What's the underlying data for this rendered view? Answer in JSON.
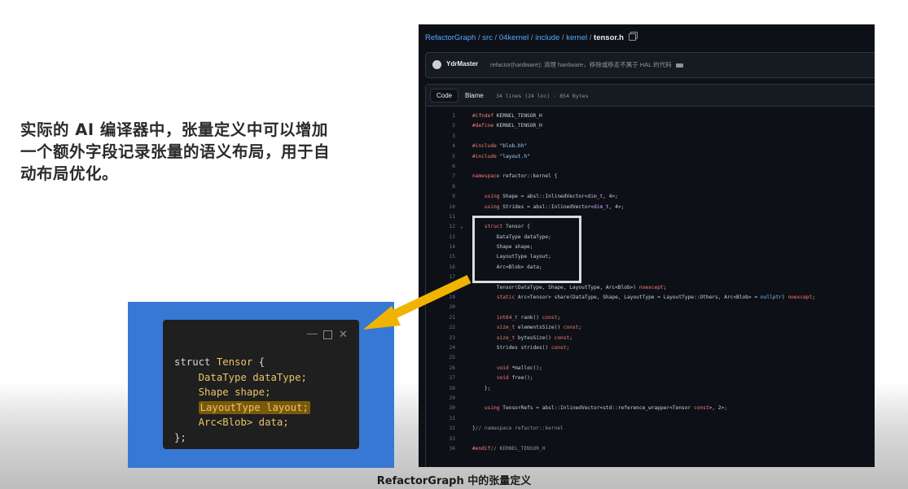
{
  "heading": "实际的 AI 编译器中，张量定义中可以增加一个额外字段记录张量的语义布局，用于自动布局优化。",
  "github": {
    "breadcrumb": {
      "repo": "RefactorGraph",
      "sep": " / ",
      "parts": [
        "src",
        "04kernel",
        "include",
        "kernel"
      ],
      "file": "tensor.h"
    },
    "commit": {
      "author": "YdrMaster",
      "message": "refactor(hardware): 清理 hardware，移除或移走不属于 HAL 的代码"
    },
    "tabs": {
      "code": "Code",
      "blame": "Blame"
    },
    "file_info": "34 lines (24 loc) · 854 Bytes",
    "code_lines": [
      {
        "n": "1",
        "t": "#ifndef KERNEL_TENSOR_H"
      },
      {
        "n": "2",
        "t": "#define KERNEL_TENSOR_H"
      },
      {
        "n": "3",
        "t": ""
      },
      {
        "n": "4",
        "t": "#include \"blob.hh\""
      },
      {
        "n": "5",
        "t": "#include \"layout.h\""
      },
      {
        "n": "6",
        "t": ""
      },
      {
        "n": "7",
        "t": "namespace refactor::kernel {"
      },
      {
        "n": "8",
        "t": ""
      },
      {
        "n": "9",
        "t": "    using Shape = absl::InlinedVector<dim_t, 4>;"
      },
      {
        "n": "10",
        "t": "    using Strides = absl::InlinedVector<dim_t, 4>;"
      },
      {
        "n": "11",
        "t": ""
      },
      {
        "n": "12",
        "t": "    struct Tensor {",
        "fold": "⌄"
      },
      {
        "n": "13",
        "t": "        DataType dataType;"
      },
      {
        "n": "14",
        "t": "        Shape shape;"
      },
      {
        "n": "15",
        "t": "        LayoutType layout;"
      },
      {
        "n": "16",
        "t": "        Arc<Blob> data;"
      },
      {
        "n": "17",
        "t": ""
      },
      {
        "n": "18",
        "t": "        Tensor(DataType, Shape, LayoutType, Arc<Blob>) noexcept;"
      },
      {
        "n": "19",
        "t": "        static Arc<Tensor> share(DataType, Shape, LayoutType = LayoutType::Others, Arc<Blob> = nullptr) noexcept;"
      },
      {
        "n": "20",
        "t": ""
      },
      {
        "n": "21",
        "t": "        int64_t rank() const;"
      },
      {
        "n": "22",
        "t": "        size_t elementsSize() const;"
      },
      {
        "n": "23",
        "t": "        size_t bytesSize() const;"
      },
      {
        "n": "24",
        "t": "        Strides strides() const;"
      },
      {
        "n": "25",
        "t": ""
      },
      {
        "n": "26",
        "t": "        void *malloc();"
      },
      {
        "n": "27",
        "t": "        void free();"
      },
      {
        "n": "28",
        "t": "    };"
      },
      {
        "n": "29",
        "t": ""
      },
      {
        "n": "30",
        "t": "    using TensorRefs = absl::InlinedVector<std::reference_wrapper<Tensor const>, 2>;"
      },
      {
        "n": "31",
        "t": ""
      },
      {
        "n": "32",
        "t": "}// namespace refactor::kernel"
      },
      {
        "n": "33",
        "t": ""
      },
      {
        "n": "34",
        "t": "#endif// KERNEL_TENSOR_H"
      }
    ]
  },
  "caption": "RefactorGraph 中的张量定义",
  "snippet": {
    "window_controls": {
      "minimize": "—",
      "close": "✕"
    },
    "lines": [
      "struct Tensor {",
      "    DataType dataType;",
      "    Shape shape;",
      "    LayoutType layout;",
      "    Arc<Blob> data;",
      "};"
    ],
    "highlighted_line_index": 3
  },
  "colors": {
    "arrow": "#f0b400",
    "highlight_box": "#dcdcdc",
    "snippet_bg": "#3778d4",
    "editor_bg": "#0d1117"
  },
  "icons": [
    "copy-icon",
    "avatar",
    "more-icon",
    "fold-chevron-icon",
    "window-minimize-icon",
    "window-maximize-icon",
    "window-close-icon",
    "arrow-pointer"
  ]
}
